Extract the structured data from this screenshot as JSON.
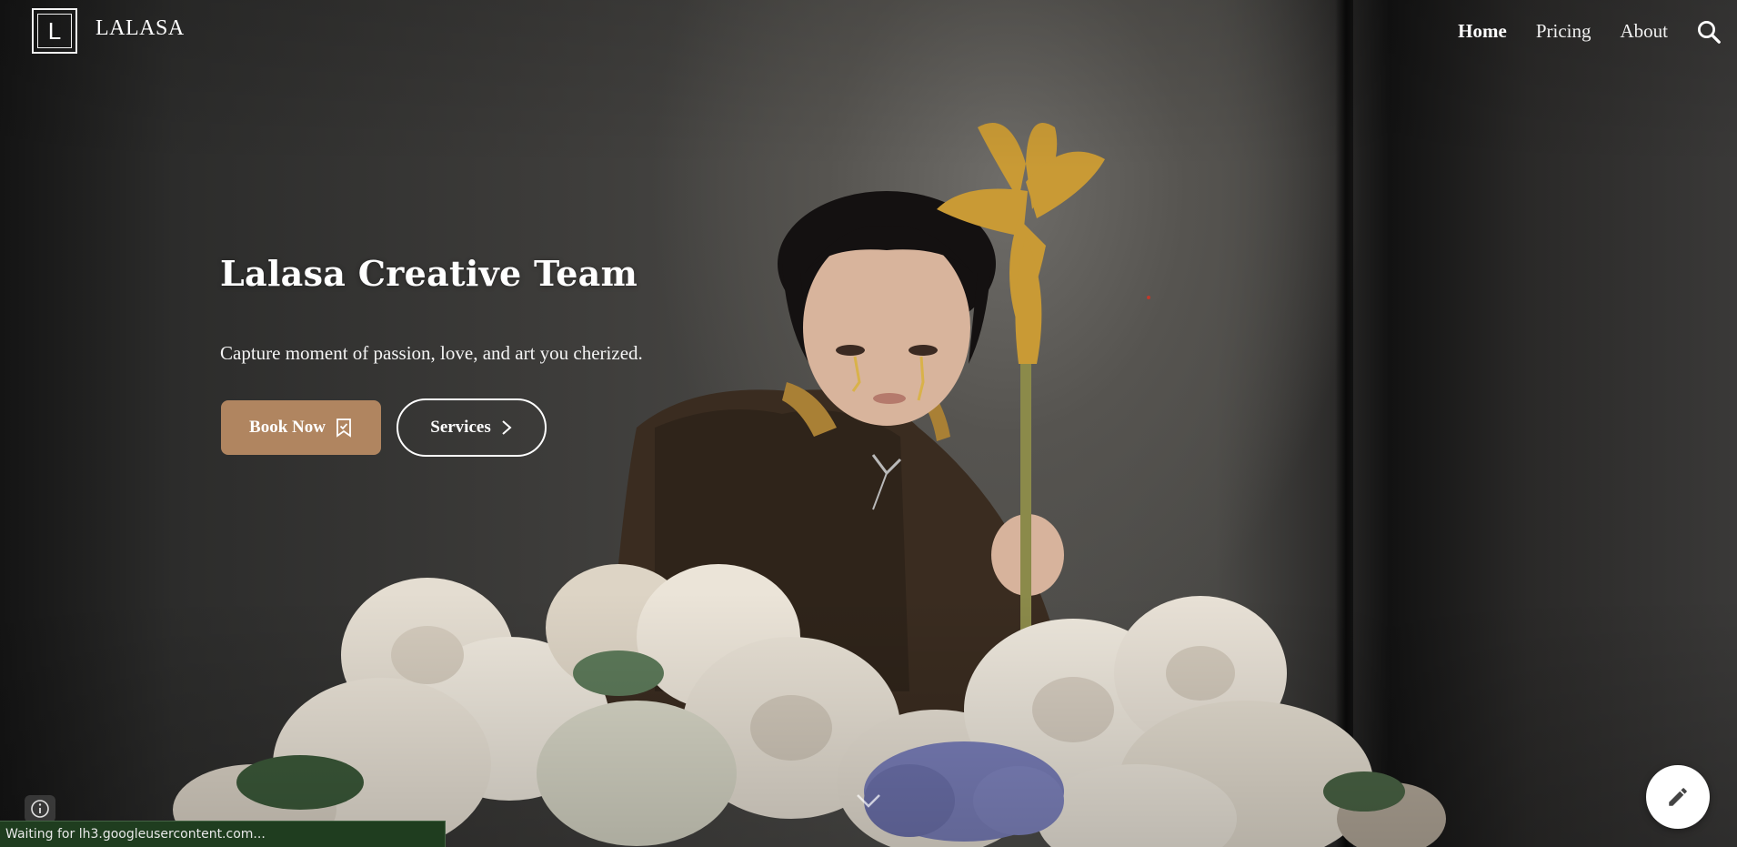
{
  "header": {
    "logo_letter": "L",
    "site_title": "LALASA",
    "nav": [
      {
        "label": "Home",
        "active": true
      },
      {
        "label": "Pricing",
        "active": false
      },
      {
        "label": "About",
        "active": false
      }
    ],
    "search_icon": "search-icon"
  },
  "hero": {
    "title": "Lalasa Creative Team",
    "subtitle": "Capture moment of passion, love, and art you cherized.",
    "book_label": "Book Now",
    "book_icon": "bookmark-check-icon",
    "services_label": "Services",
    "services_icon": "chevron-right-icon",
    "book_color": "#b08560"
  },
  "footer": {
    "status_text": "Waiting for lh3.googleusercontent.com...",
    "info_icon": "info-icon",
    "edit_icon": "pencil-icon",
    "scroll_icon": "chevron-down-icon"
  }
}
